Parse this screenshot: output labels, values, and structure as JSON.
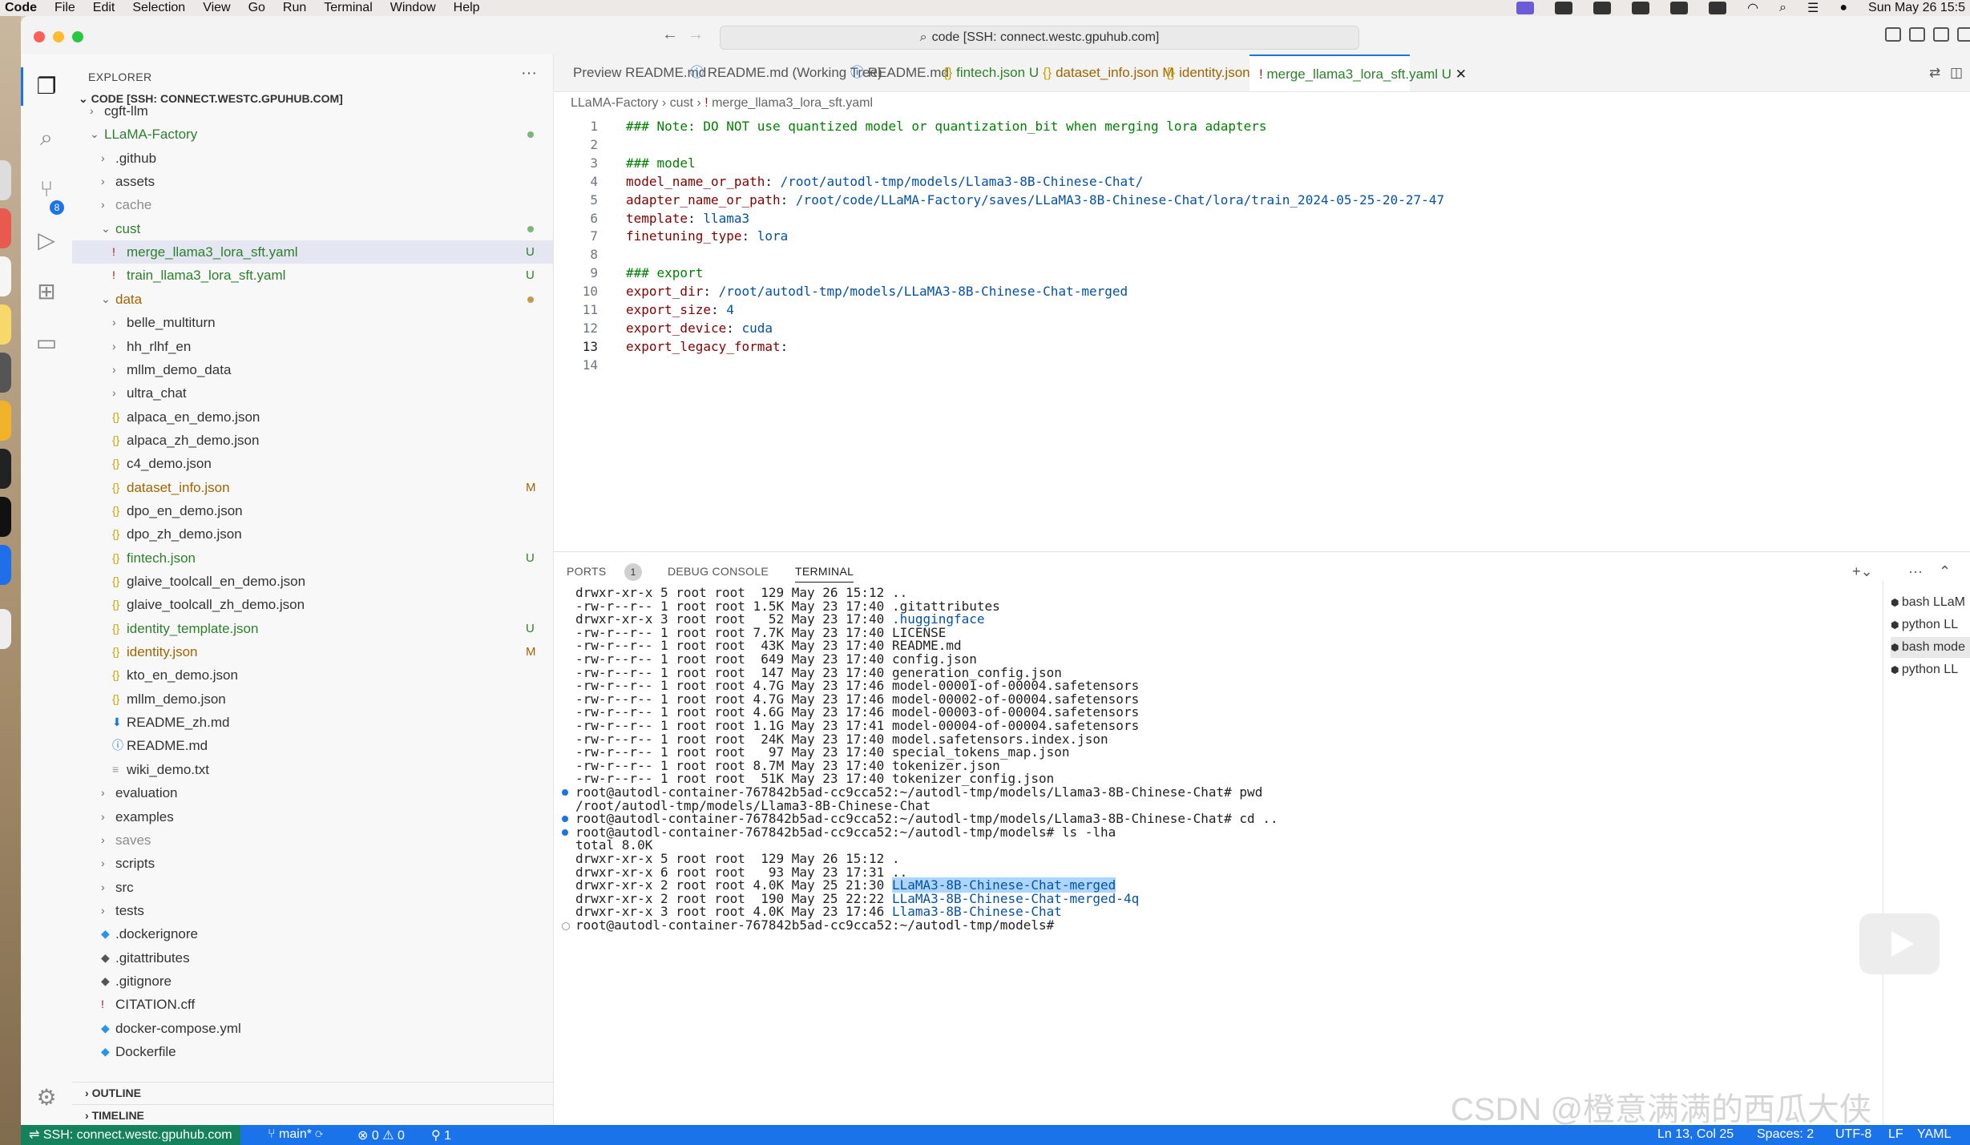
{
  "menubar": {
    "app": "Code",
    "items": [
      "File",
      "Edit",
      "Selection",
      "View",
      "Go",
      "Run",
      "Terminal",
      "Window",
      "Help"
    ],
    "clock": "Sun May 26  15:5"
  },
  "window": {
    "command_center": "code [SSH: connect.westc.gpuhub.com]"
  },
  "sidebar": {
    "title": "EXPLORER",
    "more": "···",
    "workspace": "CODE [SSH: CONNECT.WESTC.GPUHUB.COM]",
    "outline": "OUTLINE",
    "timeline": "TIMELINE"
  },
  "tree": [
    {
      "label": "cgft-llm",
      "depth": 0,
      "type": "folder",
      "open": false,
      "status": ""
    },
    {
      "label": "LLaMA-Factory",
      "depth": 0,
      "type": "folder",
      "open": true,
      "status": "dot",
      "color": "untr"
    },
    {
      "label": ".github",
      "depth": 1,
      "type": "folder",
      "open": false,
      "status": ""
    },
    {
      "label": "assets",
      "depth": 1,
      "type": "folder",
      "open": false,
      "status": ""
    },
    {
      "label": "cache",
      "depth": 1,
      "type": "folder",
      "open": false,
      "status": "",
      "color": "dim"
    },
    {
      "label": "cust",
      "depth": 1,
      "type": "folder",
      "open": true,
      "status": "dot",
      "color": "untr"
    },
    {
      "label": "merge_llama3_lora_sft.yaml",
      "depth": 2,
      "type": "yaml",
      "status": "U",
      "color": "untr",
      "selected": true
    },
    {
      "label": "train_llama3_lora_sft.yaml",
      "depth": 2,
      "type": "yaml",
      "status": "U",
      "color": "untr"
    },
    {
      "label": "data",
      "depth": 1,
      "type": "folder",
      "open": true,
      "status": "dot",
      "color": "mod"
    },
    {
      "label": "belle_multiturn",
      "depth": 2,
      "type": "folder",
      "open": false,
      "status": ""
    },
    {
      "label": "hh_rlhf_en",
      "depth": 2,
      "type": "folder",
      "open": false,
      "status": ""
    },
    {
      "label": "mllm_demo_data",
      "depth": 2,
      "type": "folder",
      "open": false,
      "status": ""
    },
    {
      "label": "ultra_chat",
      "depth": 2,
      "type": "folder",
      "open": false,
      "status": ""
    },
    {
      "label": "alpaca_en_demo.json",
      "depth": 2,
      "type": "json",
      "status": ""
    },
    {
      "label": "alpaca_zh_demo.json",
      "depth": 2,
      "type": "json",
      "status": ""
    },
    {
      "label": "c4_demo.json",
      "depth": 2,
      "type": "json",
      "status": ""
    },
    {
      "label": "dataset_info.json",
      "depth": 2,
      "type": "json",
      "status": "M",
      "color": "mod"
    },
    {
      "label": "dpo_en_demo.json",
      "depth": 2,
      "type": "json",
      "status": ""
    },
    {
      "label": "dpo_zh_demo.json",
      "depth": 2,
      "type": "json",
      "status": ""
    },
    {
      "label": "fintech.json",
      "depth": 2,
      "type": "json",
      "status": "U",
      "color": "untr"
    },
    {
      "label": "glaive_toolcall_en_demo.json",
      "depth": 2,
      "type": "json",
      "status": ""
    },
    {
      "label": "glaive_toolcall_zh_demo.json",
      "depth": 2,
      "type": "json",
      "status": ""
    },
    {
      "label": "identity_template.json",
      "depth": 2,
      "type": "json",
      "status": "U",
      "color": "untr"
    },
    {
      "label": "identity.json",
      "depth": 2,
      "type": "json",
      "status": "M",
      "color": "mod"
    },
    {
      "label": "kto_en_demo.json",
      "depth": 2,
      "type": "json",
      "status": ""
    },
    {
      "label": "mllm_demo.json",
      "depth": 2,
      "type": "json",
      "status": ""
    },
    {
      "label": "README_zh.md",
      "depth": 2,
      "type": "md-down",
      "status": ""
    },
    {
      "label": "README.md",
      "depth": 2,
      "type": "md-info",
      "status": ""
    },
    {
      "label": "wiki_demo.txt",
      "depth": 2,
      "type": "txt",
      "status": ""
    },
    {
      "label": "evaluation",
      "depth": 1,
      "type": "folder",
      "open": false,
      "status": ""
    },
    {
      "label": "examples",
      "depth": 1,
      "type": "folder",
      "open": false,
      "status": ""
    },
    {
      "label": "saves",
      "depth": 1,
      "type": "folder",
      "open": false,
      "status": "",
      "color": "dim"
    },
    {
      "label": "scripts",
      "depth": 1,
      "type": "folder",
      "open": false,
      "status": ""
    },
    {
      "label": "src",
      "depth": 1,
      "type": "folder",
      "open": false,
      "status": ""
    },
    {
      "label": "tests",
      "depth": 1,
      "type": "folder",
      "open": false,
      "status": ""
    },
    {
      "label": ".dockerignore",
      "depth": 1,
      "type": "docker",
      "status": ""
    },
    {
      "label": ".gitattributes",
      "depth": 1,
      "type": "git",
      "status": ""
    },
    {
      "label": ".gitignore",
      "depth": 1,
      "type": "git",
      "status": ""
    },
    {
      "label": "CITATION.cff",
      "depth": 1,
      "type": "cff",
      "status": ""
    },
    {
      "label": "docker-compose.yml",
      "depth": 1,
      "type": "docker",
      "status": ""
    },
    {
      "label": "Dockerfile",
      "depth": 1,
      "type": "docker",
      "status": ""
    }
  ],
  "tabs": [
    {
      "label": "Preview README.md",
      "icon": "",
      "status": ""
    },
    {
      "label": "README.md (Working Tree)",
      "icon": "ⓘ",
      "status": ""
    },
    {
      "label": "README.md",
      "icon": "ⓘ",
      "status": ""
    },
    {
      "label": "fintech.json",
      "icon": "{}",
      "status": "U",
      "color": "untr"
    },
    {
      "label": "dataset_info.json",
      "icon": "{}",
      "status": "M",
      "color": "mod"
    },
    {
      "label": "identity.json",
      "icon": "{}",
      "status": "M",
      "color": "mod"
    },
    {
      "label": "merge_llama3_lora_sft.yaml",
      "icon": "!",
      "status": "U",
      "color": "untr",
      "active": true
    }
  ],
  "breadcrumb": [
    "LLaMA-Factory",
    "cust",
    "merge_llama3_lora_sft.yaml"
  ],
  "editor": {
    "current_line": 13,
    "lines": [
      {
        "n": "1",
        "parts": [
          [
            "cm",
            "### Note: DO NOT use quantized model or quantization_bit when merging lora adapters"
          ]
        ]
      },
      {
        "n": "2",
        "parts": []
      },
      {
        "n": "3",
        "parts": [
          [
            "cm",
            "### model"
          ]
        ]
      },
      {
        "n": "4",
        "parts": [
          [
            "key",
            "model_name_or_path"
          ],
          [
            "",
            ": "
          ],
          [
            "val",
            "/root/autodl-tmp/models/Llama3-8B-Chinese-Chat/"
          ]
        ]
      },
      {
        "n": "5",
        "parts": [
          [
            "key",
            "adapter_name_or_path"
          ],
          [
            "",
            ": "
          ],
          [
            "val",
            "/root/code/LLaMA-Factory/saves/LLaMA3-8B-Chinese-Chat/lora/train_2024-05-25-20-27-47"
          ]
        ]
      },
      {
        "n": "6",
        "parts": [
          [
            "key",
            "template"
          ],
          [
            "",
            ": "
          ],
          [
            "val",
            "llama3"
          ]
        ]
      },
      {
        "n": "7",
        "parts": [
          [
            "key",
            "finetuning_type"
          ],
          [
            "",
            ": "
          ],
          [
            "val",
            "lora"
          ]
        ]
      },
      {
        "n": "8",
        "parts": []
      },
      {
        "n": "9",
        "parts": [
          [
            "cm",
            "### export"
          ]
        ]
      },
      {
        "n": "10",
        "parts": [
          [
            "key",
            "export_dir"
          ],
          [
            "",
            ": "
          ],
          [
            "val",
            "/root/autodl-tmp/models/LLaMA3-8B-Chinese-Chat-merged"
          ]
        ]
      },
      {
        "n": "11",
        "parts": [
          [
            "key",
            "export_size"
          ],
          [
            "",
            ": "
          ],
          [
            "val",
            "4"
          ]
        ]
      },
      {
        "n": "12",
        "parts": [
          [
            "key",
            "export_device"
          ],
          [
            "",
            ": "
          ],
          [
            "val",
            "cuda"
          ]
        ]
      },
      {
        "n": "13",
        "parts": [
          [
            "key",
            "export_legacy_format"
          ],
          [
            "",
            ":"
          ]
        ]
      },
      {
        "n": "14",
        "parts": []
      }
    ]
  },
  "panel": {
    "tabs": [
      "PORTS",
      "DEBUG CONSOLE",
      "TERMINAL"
    ],
    "ports_count": "1",
    "active_tab": "TERMINAL"
  },
  "terminal": [
    {
      "p": "drwxr-xr-x 5 root root  129 May 26 15:12 ",
      "name": "..",
      "blue": false
    },
    {
      "p": "-rw-r--r-- 1 root root 1.5K May 23 17:40 ",
      "name": ".gitattributes",
      "blue": false
    },
    {
      "p": "drwxr-xr-x 3 root root   52 May 23 17:40 ",
      "name": ".huggingface",
      "blue": true
    },
    {
      "p": "-rw-r--r-- 1 root root 7.7K May 23 17:40 ",
      "name": "LICENSE",
      "blue": false
    },
    {
      "p": "-rw-r--r-- 1 root root  43K May 23 17:40 ",
      "name": "README.md",
      "blue": false
    },
    {
      "p": "-rw-r--r-- 1 root root  649 May 23 17:40 ",
      "name": "config.json",
      "blue": false
    },
    {
      "p": "-rw-r--r-- 1 root root  147 May 23 17:40 ",
      "name": "generation_config.json",
      "blue": false
    },
    {
      "p": "-rw-r--r-- 1 root root 4.7G May 23 17:46 ",
      "name": "model-00001-of-00004.safetensors",
      "blue": false
    },
    {
      "p": "-rw-r--r-- 1 root root 4.7G May 23 17:46 ",
      "name": "model-00002-of-00004.safetensors",
      "blue": false
    },
    {
      "p": "-rw-r--r-- 1 root root 4.6G May 23 17:46 ",
      "name": "model-00003-of-00004.safetensors",
      "blue": false
    },
    {
      "p": "-rw-r--r-- 1 root root 1.1G May 23 17:41 ",
      "name": "model-00004-of-00004.safetensors",
      "blue": false
    },
    {
      "p": "-rw-r--r-- 1 root root  24K May 23 17:40 ",
      "name": "model.safetensors.index.json",
      "blue": false
    },
    {
      "p": "-rw-r--r-- 1 root root   97 May 23 17:40 ",
      "name": "special_tokens_map.json",
      "blue": false
    },
    {
      "p": "-rw-r--r-- 1 root root 8.7M May 23 17:40 ",
      "name": "tokenizer.json",
      "blue": false
    },
    {
      "p": "-rw-r--r-- 1 root root  51K May 23 17:40 ",
      "name": "tokenizer_config.json",
      "blue": false
    },
    {
      "p": "root@autodl-container-767842b5ad-cc9cca52:~/autodl-tmp/models/Llama3-8B-Chinese-Chat# pwd",
      "name": "",
      "blue": false,
      "dot": "blue"
    },
    {
      "p": "/root/autodl-tmp/models/Llama3-8B-Chinese-Chat",
      "name": "",
      "blue": false
    },
    {
      "p": "root@autodl-container-767842b5ad-cc9cca52:~/autodl-tmp/models/Llama3-8B-Chinese-Chat# cd ..",
      "name": "",
      "blue": false,
      "dot": "blue"
    },
    {
      "p": "root@autodl-container-767842b5ad-cc9cca52:~/autodl-tmp/models# ls -lha",
      "name": "",
      "blue": false,
      "dot": "blue"
    },
    {
      "p": "total 8.0K",
      "name": "",
      "blue": false
    },
    {
      "p": "drwxr-xr-x 5 root root  129 May 26 15:12 ",
      "name": ".",
      "blue": false
    },
    {
      "p": "drwxr-xr-x 6 root root   93 May 23 17:31 ",
      "name": "..",
      "blue": false
    },
    {
      "p": "drwxr-xr-x 2 root root 4.0K May 25 21:30 ",
      "name": "LLaMA3-8B-Chinese-Chat-merged",
      "blue": true,
      "highlight": true
    },
    {
      "p": "drwxr-xr-x 2 root root  190 May 25 22:22 ",
      "name": "LLaMA3-8B-Chinese-Chat-merged-4q",
      "blue": true
    },
    {
      "p": "drwxr-xr-x 3 root root 4.0K May 23 17:46 ",
      "name": "Llama3-8B-Chinese-Chat",
      "blue": true
    },
    {
      "p": "root@autodl-container-767842b5ad-cc9cca52:~/autodl-tmp/models# ",
      "name": "",
      "blue": false,
      "dot": "hollow"
    }
  ],
  "terminal_list": [
    {
      "label": "bash  LLaM"
    },
    {
      "label": "python  LL"
    },
    {
      "label": "bash  mode",
      "selected": true
    },
    {
      "label": "python  LL"
    }
  ],
  "statusbar": {
    "remote": "SSH: connect.westc.gpuhub.com",
    "branch": "main*",
    "problems": "⊗ 0 ⚠ 0",
    "ports": "1",
    "cursor": "Ln 13, Col 25",
    "spaces": "Spaces: 2",
    "encoding": "UTF-8",
    "eol": "LF",
    "language": "YAML"
  },
  "watermark": "CSDN @橙意满满的西瓜大侠",
  "colors": {
    "accent": "#1a73e8",
    "remote": "#16825d",
    "modified": "#a06400",
    "untracked": "#2d7f2d"
  }
}
